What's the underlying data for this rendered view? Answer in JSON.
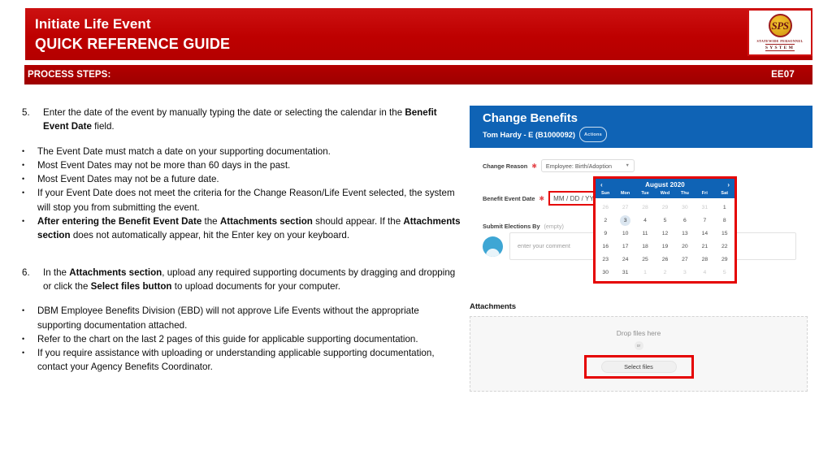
{
  "header": {
    "title_line1": "Initiate Life Event",
    "title_line2": "QUICK REFERENCE GUIDE",
    "process_label": "PROCESS STEPS:",
    "process_code": "EE07",
    "logo": {
      "seal_text": "SPS",
      "word1": "STATEWIDE PERSONNEL",
      "word2": "SYSTEM"
    }
  },
  "steps": [
    {
      "number": "5.",
      "text_parts": [
        {
          "t": "Enter the date of the event by manually typing the date or selecting the calendar in the ",
          "b": false
        },
        {
          "t": "Benefit Event Date",
          "b": true
        },
        {
          "t": " field.",
          "b": false
        }
      ],
      "bullets": [
        [
          {
            "t": "The Event Date must match a date on your supporting documentation.",
            "b": false
          }
        ],
        [
          {
            "t": "Most Event Dates may not be more than 60 days in the past.",
            "b": false
          }
        ],
        [
          {
            "t": "Most Event Dates may not be a future date.",
            "b": false
          }
        ],
        [
          {
            "t": "If your Event Date does not meet the criteria for the Change Reason/Life Event selected, the system will stop you from submitting the event.",
            "b": false
          }
        ],
        [
          {
            "t": "After entering the Benefit Event Date",
            "b": true
          },
          {
            "t": " the ",
            "b": false
          },
          {
            "t": "Attachments section",
            "b": true
          },
          {
            "t": " should appear.  If the ",
            "b": false
          },
          {
            "t": "Attachments section",
            "b": true
          },
          {
            "t": " does not automatically appear, hit the Enter key on your keyboard.",
            "b": false
          }
        ]
      ]
    },
    {
      "number": "6.",
      "text_parts": [
        {
          "t": "In the ",
          "b": false
        },
        {
          "t": "Attachments section",
          "b": true
        },
        {
          "t": ", upload any required supporting documents by dragging  and  dropping  or click the ",
          "b": false
        },
        {
          "t": "Select files button",
          "b": true
        },
        {
          "t": " to upload documents for your computer.",
          "b": false
        }
      ],
      "bullets": [
        [
          {
            "t": "DBM Employee Benefits Division (EBD) will not approve Life Events without the appropriate supporting documentation attached.",
            "b": false
          }
        ],
        [
          {
            "t": "Refer to the chart on the last 2 pages of this guide for applicable supporting documentation.",
            "b": false
          }
        ],
        [
          {
            "t": "If you require assistance with uploading or understanding applicable supporting documentation, contact your Agency Benefits Coordinator.",
            "b": false
          }
        ]
      ]
    }
  ],
  "screenshot": {
    "app_title": "Change Benefits",
    "employee": "Tom Hardy - E (B1000092)",
    "actions_label": "Actions",
    "fields": {
      "change_reason_label": "Change Reason",
      "change_reason_value": "Employee: Birth/Adoption",
      "benefit_event_date_label": "Benefit Event Date",
      "benefit_event_date_value": "MM / DD / YYYY",
      "submit_elections_label": "Submit Elections By",
      "submit_elections_value": "(empty)"
    },
    "comment_placeholder": "enter your comment",
    "calendar": {
      "prev_label": "‹",
      "next_label": "›",
      "month_label": "August 2020",
      "day_headers": [
        "Sun",
        "Mon",
        "Tue",
        "Wed",
        "Thu",
        "Fri",
        "Sat"
      ],
      "selected_day": "3",
      "weeks": [
        [
          {
            "d": "26",
            "m": true
          },
          {
            "d": "27",
            "m": true
          },
          {
            "d": "28",
            "m": true
          },
          {
            "d": "29",
            "m": true
          },
          {
            "d": "30",
            "m": true
          },
          {
            "d": "31",
            "m": true
          },
          {
            "d": "1",
            "m": false
          }
        ],
        [
          {
            "d": "2",
            "m": false
          },
          {
            "d": "3",
            "m": false,
            "s": true
          },
          {
            "d": "4",
            "m": false
          },
          {
            "d": "5",
            "m": false
          },
          {
            "d": "6",
            "m": false
          },
          {
            "d": "7",
            "m": false
          },
          {
            "d": "8",
            "m": false
          }
        ],
        [
          {
            "d": "9",
            "m": false
          },
          {
            "d": "10",
            "m": false
          },
          {
            "d": "11",
            "m": false
          },
          {
            "d": "12",
            "m": false
          },
          {
            "d": "13",
            "m": false
          },
          {
            "d": "14",
            "m": false
          },
          {
            "d": "15",
            "m": false
          }
        ],
        [
          {
            "d": "16",
            "m": false
          },
          {
            "d": "17",
            "m": false
          },
          {
            "d": "18",
            "m": false
          },
          {
            "d": "19",
            "m": false
          },
          {
            "d": "20",
            "m": false
          },
          {
            "d": "21",
            "m": false
          },
          {
            "d": "22",
            "m": false
          }
        ],
        [
          {
            "d": "23",
            "m": false
          },
          {
            "d": "24",
            "m": false
          },
          {
            "d": "25",
            "m": false
          },
          {
            "d": "26",
            "m": false
          },
          {
            "d": "27",
            "m": false
          },
          {
            "d": "28",
            "m": false
          },
          {
            "d": "29",
            "m": false
          }
        ],
        [
          {
            "d": "30",
            "m": false
          },
          {
            "d": "31",
            "m": false
          },
          {
            "d": "1",
            "m": true
          },
          {
            "d": "2",
            "m": true
          },
          {
            "d": "3",
            "m": true
          },
          {
            "d": "4",
            "m": true
          },
          {
            "d": "5",
            "m": true
          }
        ]
      ]
    },
    "attachments": {
      "title": "Attachments",
      "drop_text": "Drop files here",
      "or_text": "or",
      "select_files_label": "Select files"
    }
  },
  "colors": {
    "brand_red": "#c00000",
    "highlight_red": "#e50000",
    "workday_blue": "#0f63b5"
  }
}
